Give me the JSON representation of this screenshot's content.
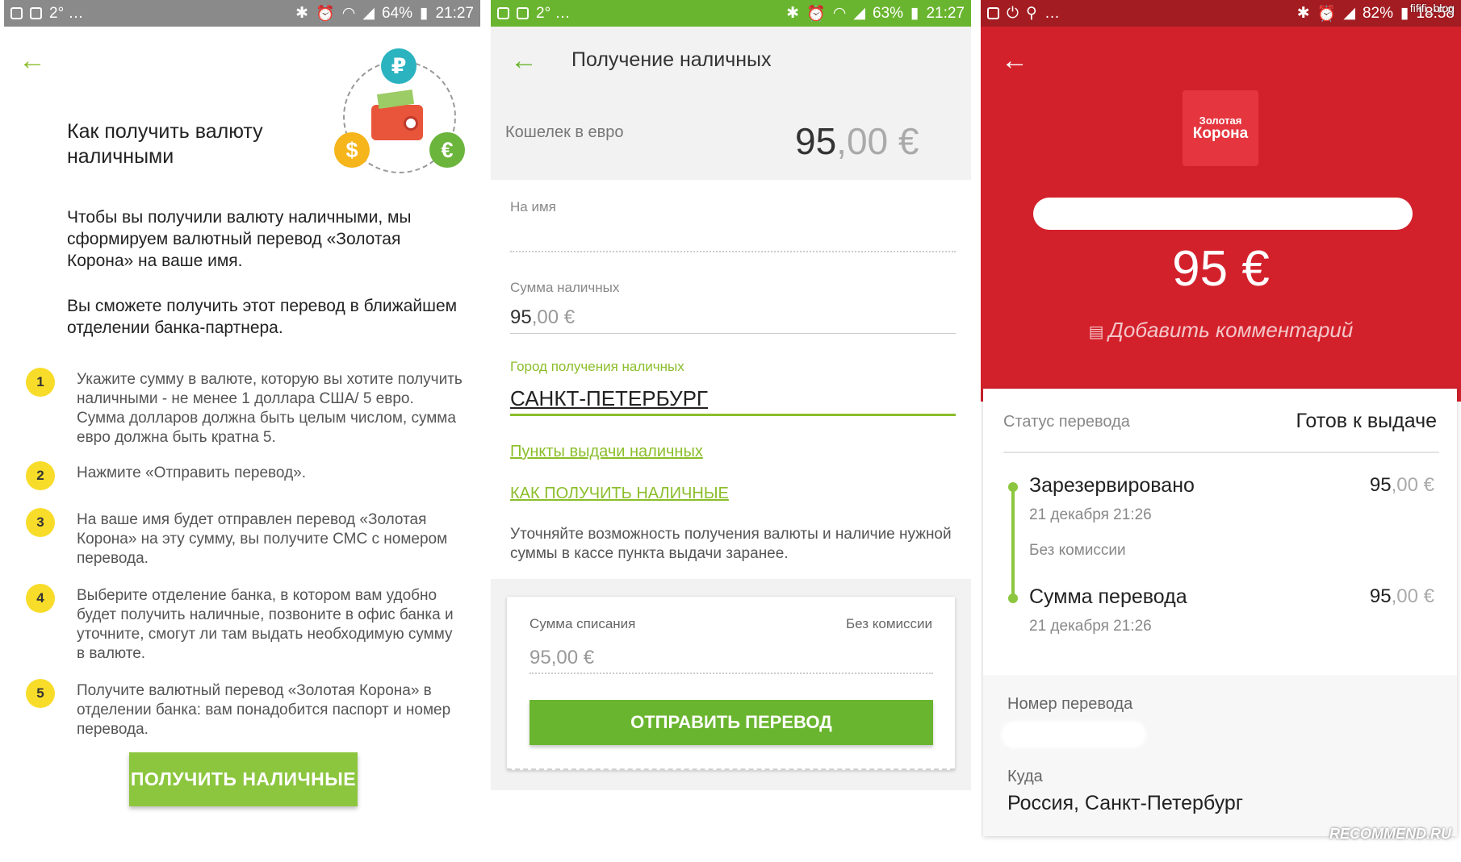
{
  "panel1": {
    "status": {
      "left": "2° …",
      "battery": "64%",
      "time": "21:27"
    },
    "title": "Как получить валюту наличными",
    "intro": "Чтобы вы получили валюту наличными, мы сформируем валютный перевод «Золотая Корона» на ваше имя.",
    "intro2": "Вы сможете получить этот перевод в ближайшем отделении банка-партнера.",
    "coins": {
      "rub": "₽",
      "usd": "$",
      "eur": "€"
    },
    "steps": [
      {
        "num": "1",
        "text": "Укажите сумму в валюте, которую вы хотите получить наличными - не менее 1 доллара США/ 5 евро. Сумма долларов должна быть целым числом, сумма евро должна быть кратна 5."
      },
      {
        "num": "2",
        "text": "Нажмите «Отправить перевод»."
      },
      {
        "num": "3",
        "text": "На ваше имя будет отправлен перевод «Золотая Корона» на эту сумму, вы получите СМС с номером перевода."
      },
      {
        "num": "4",
        "text": "Выберите отделение банка, в котором вам удобно будет получить наличные, позвоните в офис банка и уточните, смогут ли там выдать необходимую сумму в валюте."
      },
      {
        "num": "5",
        "text": "Получите валютный перевод «Золотая Корона» в отделении банка: вам понадобится паспорт и номер перевода."
      }
    ],
    "button": "ПОЛУЧИТЬ НАЛИЧНЫЕ",
    "accent": "#8cc63f"
  },
  "panel2": {
    "status": {
      "left": "2° …",
      "battery": "63%",
      "time": "21:27"
    },
    "title": "Получение наличных",
    "wallet_label": "Кошелек в евро",
    "wallet_int": "95",
    "wallet_dec": ",00 €",
    "name_label": "На имя",
    "sum_label": "Сумма наличных",
    "sum_int": "95",
    "sum_dec": ",00 €",
    "city_label": "Город получения наличных",
    "city_value": "САНКТ-ПЕТЕРБУРГ",
    "link_points": "Пункты выдачи наличных",
    "link_how": "КАК ПОЛУЧИТЬ НАЛИЧНЫЕ",
    "note": "Уточняйте возможность получения валюты и наличие нужной суммы в кассе пункта выдачи заранее.",
    "debit_label": "Сумма списания",
    "commission": "Без комиссии",
    "debit_value": "95,00 €",
    "button": "ОТПРАВИТЬ ПЕРЕВОД",
    "accent": "#6ab52f"
  },
  "panel3": {
    "status": {
      "left": "…",
      "battery": "82%",
      "time": "18:58"
    },
    "watermark_top": "fififi_blog",
    "logo_line1": "Золотая",
    "logo_line2": "Корона",
    "amount": "95 €",
    "add_comment": "Добавить комментарий",
    "status_label": "Статус перевода",
    "status_value": "Готов к выдаче",
    "events": [
      {
        "title": "Зарезервировано",
        "date": "21 декабря 21:26",
        "note": "Без комиссии",
        "amount_int": "95",
        "amount_dec": ",00 €"
      },
      {
        "title": "Сумма перевода",
        "date": "21 декабря 21:26",
        "amount_int": "95",
        "amount_dec": ",00 €"
      }
    ],
    "number_label": "Номер перевода",
    "where_label": "Куда",
    "where_value": "Россия, Санкт-Петербург",
    "watermark": "RECOMMEND.RU",
    "accent": "#d3212c"
  }
}
